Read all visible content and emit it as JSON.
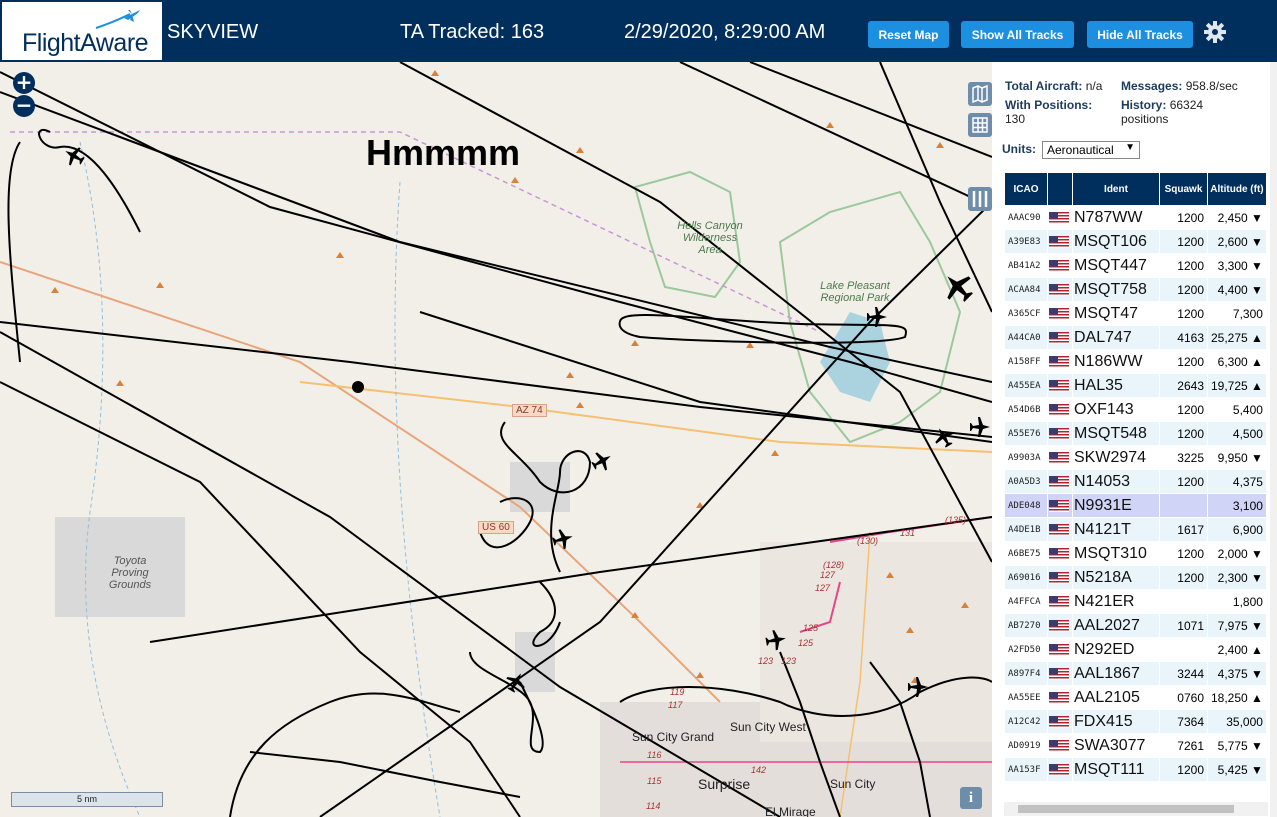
{
  "header": {
    "logo_text": "FlightAware",
    "app_name": "SKYVIEW",
    "tracked": "TA Tracked: 163",
    "datetime": "2/29/2020, 8:29:00 AM",
    "buttons": {
      "reset": "Reset Map",
      "show_all": "Show All Tracks",
      "hide_all": "Hide All Tracks"
    },
    "gear_icon": "gear-icon"
  },
  "map": {
    "annotation": "Hmmmm",
    "zoom_in": "+",
    "zoom_out": "−",
    "scale": "5 nm",
    "info": "i",
    "labels": {
      "wilderness": "Hells Canyon Wilderness Area",
      "lake": "Lake Pleasant Regional Park",
      "proving": "Toyota Proving Grounds",
      "sun_city_grand": "Sun City Grand",
      "sun_city_west": "Sun City West",
      "surprise": "Surprise",
      "sun_city": "Sun City",
      "el_mirage": "El Mirage",
      "az74": "AZ 74",
      "us60": "US 60"
    },
    "road_numbers": [
      "131",
      "(130)",
      "(128)",
      "127",
      "127",
      "125",
      "125",
      "123",
      "123",
      "(135)",
      "119",
      "117",
      "116",
      "115",
      "114",
      "142"
    ]
  },
  "stats": {
    "total_label": "Total Aircraft:",
    "total_value": "n/a",
    "messages_label": "Messages:",
    "messages_value": "958.8/sec",
    "positions_label": "With Positions:",
    "positions_value": "130",
    "history_label": "History:",
    "history_value": "66324 positions",
    "units_label": "Units:",
    "units_value": "Aeronautical"
  },
  "table": {
    "headers": {
      "icao": "ICAO",
      "ident": "Ident",
      "squawk": "Squawk",
      "altitude": "Altitude (ft)"
    },
    "rows": [
      {
        "icao": "AAAC90",
        "ident": "N787WW",
        "squawk": "1200",
        "alt": "2,450 ▼"
      },
      {
        "icao": "A39E83",
        "ident": "MSQT106",
        "squawk": "1200",
        "alt": "2,600 ▼"
      },
      {
        "icao": "AB41A2",
        "ident": "MSQT447",
        "squawk": "1200",
        "alt": "3,300 ▼"
      },
      {
        "icao": "ACAA84",
        "ident": "MSQT758",
        "squawk": "1200",
        "alt": "4,400 ▼"
      },
      {
        "icao": "A365CF",
        "ident": "MSQT47",
        "squawk": "1200",
        "alt": "7,300"
      },
      {
        "icao": "A44CA0",
        "ident": "DAL747",
        "squawk": "4163",
        "alt": "25,275 ▲"
      },
      {
        "icao": "A158FF",
        "ident": "N186WW",
        "squawk": "1200",
        "alt": "6,300 ▲"
      },
      {
        "icao": "A455EA",
        "ident": "HAL35",
        "squawk": "2643",
        "alt": "19,725 ▲"
      },
      {
        "icao": "A54D6B",
        "ident": "OXF143",
        "squawk": "1200",
        "alt": "5,400"
      },
      {
        "icao": "A55E76",
        "ident": "MSQT548",
        "squawk": "1200",
        "alt": "4,500"
      },
      {
        "icao": "A9903A",
        "ident": "SKW2974",
        "squawk": "3225",
        "alt": "9,950 ▼"
      },
      {
        "icao": "A0A5D3",
        "ident": "N14053",
        "squawk": "1200",
        "alt": "4,375"
      },
      {
        "icao": "ADE048",
        "ident": "N9931E",
        "squawk": "",
        "alt": "3,100"
      },
      {
        "icao": "A4DE1B",
        "ident": "N4121T",
        "squawk": "1617",
        "alt": "6,900"
      },
      {
        "icao": "A6BE75",
        "ident": "MSQT310",
        "squawk": "1200",
        "alt": "2,000 ▼"
      },
      {
        "icao": "A69016",
        "ident": "N5218A",
        "squawk": "1200",
        "alt": "2,300 ▼"
      },
      {
        "icao": "A4FFCA",
        "ident": "N421ER",
        "squawk": "",
        "alt": "1,800"
      },
      {
        "icao": "AB7270",
        "ident": "AAL2027",
        "squawk": "1071",
        "alt": "7,975 ▼"
      },
      {
        "icao": "A2FD50",
        "ident": "N292ED",
        "squawk": "",
        "alt": "2,400 ▲"
      },
      {
        "icao": "A897F4",
        "ident": "AAL1867",
        "squawk": "3244",
        "alt": "4,375 ▼"
      },
      {
        "icao": "AA55EE",
        "ident": "AAL2105",
        "squawk": "0760",
        "alt": "18,250 ▲"
      },
      {
        "icao": "A12C42",
        "ident": "FDX415",
        "squawk": "7364",
        "alt": "35,000"
      },
      {
        "icao": "AD0919",
        "ident": "SWA3077",
        "squawk": "7261",
        "alt": "5,775 ▼"
      },
      {
        "icao": "AA153F",
        "ident": "MSQT111",
        "squawk": "1200",
        "alt": "5,425 ▼"
      }
    ],
    "selected_index": 12
  },
  "colors": {
    "header_bg": "#002f5d",
    "button_bg": "#1d8fe0",
    "map_bg": "#f2efe9",
    "water": "#aad3df",
    "track": "#000000",
    "selected_row": "#d0d4f6"
  }
}
